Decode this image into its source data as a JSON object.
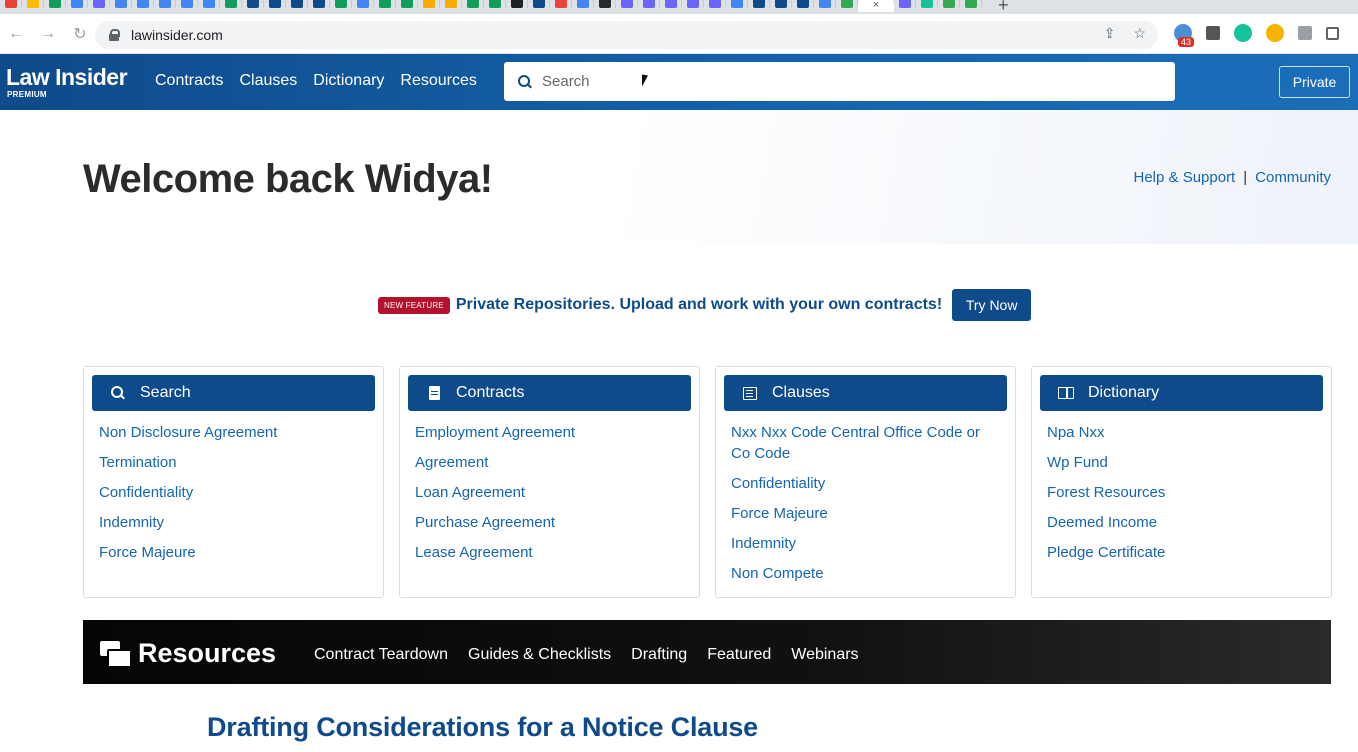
{
  "browser": {
    "url": "lawinsider.com",
    "extension_badge": "43",
    "tab_close": "×",
    "new_tab": "+"
  },
  "site": {
    "logo": "Law Insider",
    "logo_tier": "PREMIUM",
    "nav": [
      "Contracts",
      "Clauses",
      "Dictionary",
      "Resources"
    ],
    "search_placeholder": "Search",
    "private_button": "Private"
  },
  "welcome": {
    "title": "Welcome back Widya!",
    "help_link": "Help & Support",
    "separator": "|",
    "community_link": "Community"
  },
  "promo": {
    "badge": "NEW FEATURE",
    "text": "Private Repositories. Upload and work with your own contracts!",
    "button": "Try Now"
  },
  "cards": [
    {
      "title": "Search",
      "icon": "search-icon",
      "items": [
        "Non Disclosure Agreement",
        "Termination",
        "Confidentiality",
        "Indemnity",
        "Force Majeure"
      ]
    },
    {
      "title": "Contracts",
      "icon": "document-icon",
      "items": [
        "Employment Agreement",
        "Agreement",
        "Loan Agreement",
        "Purchase Agreement",
        "Lease Agreement"
      ]
    },
    {
      "title": "Clauses",
      "icon": "list-icon",
      "items": [
        "Nxx Nxx Code Central Office Code or Co Code",
        "Confidentiality",
        "Force Majeure",
        "Indemnity",
        "Non Compete"
      ]
    },
    {
      "title": "Dictionary",
      "icon": "book-icon",
      "items": [
        "Npa Nxx",
        "Wp Fund",
        "Forest Resources",
        "Deemed Income",
        "Pledge Certificate"
      ]
    }
  ],
  "resources": {
    "title": "Resources",
    "nav": [
      "Contract Teardown",
      "Guides & Checklists",
      "Drafting",
      "Featured",
      "Webinars"
    ]
  },
  "article_title": "Drafting Considerations for a Notice Clause",
  "colors": {
    "brand_blue": "#0f4a8a",
    "link_blue": "#1565b0",
    "new_badge_red": "#b3122e"
  }
}
